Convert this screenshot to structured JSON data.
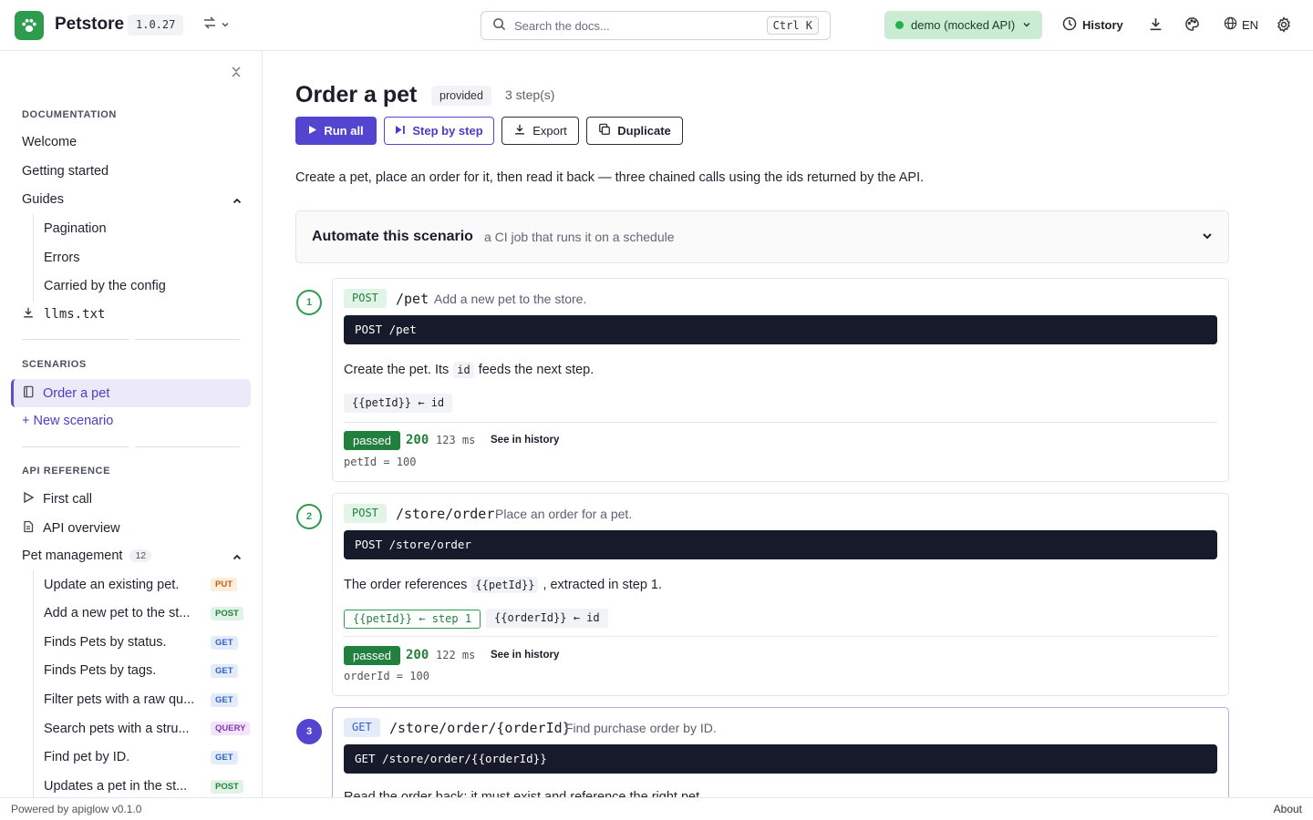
{
  "header": {
    "brand": "Petstore",
    "version": "1.0.27",
    "search_placeholder": "Search the docs...",
    "search_shortcut": "Ctrl K",
    "environment": "demo (mocked API)",
    "history_label": "History",
    "language": "EN"
  },
  "sidebar": {
    "documentation_title": "DOCUMENTATION",
    "doc_items": [
      "Welcome",
      "Getting started",
      "Guides"
    ],
    "guide_items": [
      "Pagination",
      "Errors",
      "Carried by the config"
    ],
    "llms_label": "llms.txt",
    "scenarios_title": "SCENARIOS",
    "scenario_active": "Order a pet",
    "new_scenario": "+ New scenario",
    "api_title": "API REFERENCE",
    "api_items": [
      "First call",
      "API overview"
    ],
    "group_label": "Pet management",
    "group_count": "12",
    "endpoints": [
      {
        "label": "Update an existing pet.",
        "method": "PUT"
      },
      {
        "label": "Add a new pet to the st...",
        "method": "POST"
      },
      {
        "label": "Finds Pets by status.",
        "method": "GET"
      },
      {
        "label": "Finds Pets by tags.",
        "method": "GET"
      },
      {
        "label": "Filter pets with a raw qu...",
        "method": "GET"
      },
      {
        "label": "Search pets with a stru...",
        "method": "QUERY"
      },
      {
        "label": "Find pet by ID.",
        "method": "GET"
      },
      {
        "label": "Updates a pet in the st...",
        "method": "POST"
      }
    ]
  },
  "scenario": {
    "title": "Order a pet",
    "tag": "provided",
    "steps_count": "3 step(s)",
    "buttons": {
      "run_all": "Run all",
      "step_by_step": "Step by step",
      "export": "Export",
      "duplicate": "Duplicate"
    },
    "description": "Create a pet, place an order for it, then read it back — three chained calls using the ids returned by the API.",
    "automate_title": "Automate this scenario",
    "automate_subtitle": "a CI job that runs it on a schedule"
  },
  "steps": [
    {
      "num": "1",
      "method": "POST",
      "path": "/pet",
      "summary": "Add a new pet to the store.",
      "code": "POST /pet",
      "note_pre": "Create the pet. Its",
      "note_code": "id",
      "note_post": "feeds the next step.",
      "chips": [
        "{{petId}} ← id"
      ],
      "result": "passed",
      "status": "200",
      "duration": "123 ms",
      "history_link": "See in history",
      "extracted": "petId = 100"
    },
    {
      "num": "2",
      "method": "POST",
      "path": "/store/order",
      "summary": "Place an order for a pet.",
      "code": "POST /store/order",
      "note_pre": "The order references",
      "note_code": "{{petId}}",
      "note_post": ", extracted in step 1.",
      "chips": [
        "{{petId}} ← step 1",
        "{{orderId}} ← id"
      ],
      "result": "passed",
      "status": "200",
      "duration": "122 ms",
      "history_link": "See in history",
      "extracted": "orderId = 100"
    },
    {
      "num": "3",
      "method": "GET",
      "path": "/store/order/{orderId}",
      "summary": "Find purchase order by ID.",
      "code": "GET /store/order/{{orderId}}",
      "note": "Read the order back: it must exist and reference the right pet."
    }
  ],
  "footer": {
    "powered": "Powered by apiglow v0.1.0",
    "about": "About"
  }
}
